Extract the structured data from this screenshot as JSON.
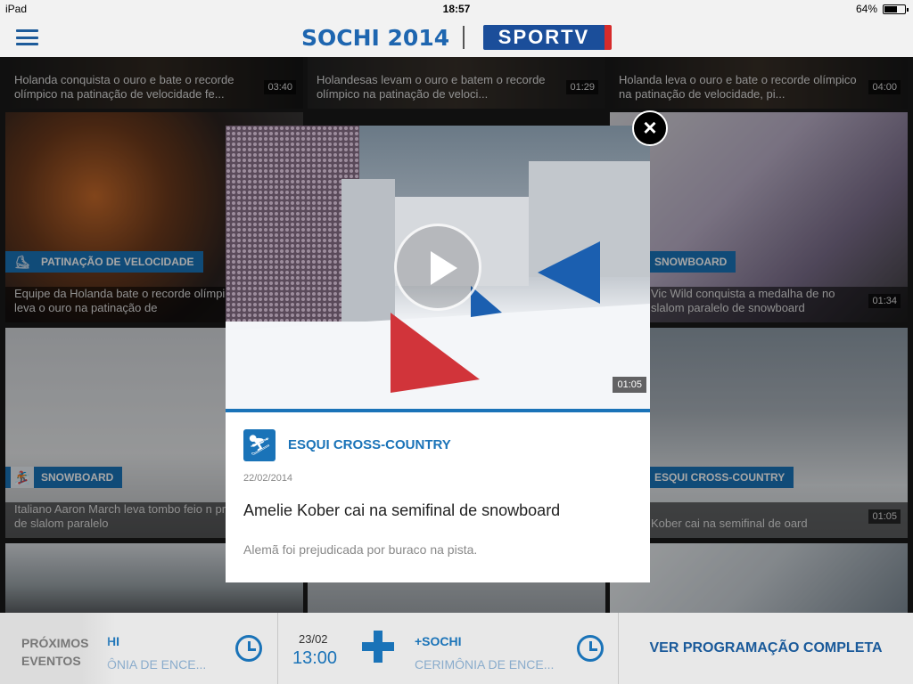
{
  "status": {
    "device": "iPad",
    "time": "18:57",
    "battery": "64%",
    "battery_fill": 0.64
  },
  "header": {
    "logo_left": "SOCHI 2014",
    "logo_right": "SPORTV"
  },
  "tiles": [
    {
      "caption": "Holanda conquista o ouro e bate o recorde olímpico na patinação de velocidade fe...",
      "duration": "03:40"
    },
    {
      "caption": "Holandesas levam o ouro e batem o recorde olímpico na patinação de veloci...",
      "duration": "01:29"
    },
    {
      "caption": "Holanda leva o ouro e bate o recorde olímpico na patinação de velocidade, pi...",
      "duration": "04:00"
    },
    {
      "sport": "PATINAÇÃO DE VELOCIDADE",
      "caption": "Equipe da Holanda bate o recorde olímpico e leva o ouro na patinação de",
      "duration": ""
    },
    {
      "sport": "SNOWBOARD",
      "caption": "Vic Wild conquista a medalha de no slalom paralelo de snowboard",
      "duration": "01:34"
    },
    {
      "sport": "SNOWBOARD",
      "caption": "Italiano Aaron March leva tombo feio n prova de slalom paralelo",
      "duration": ""
    },
    {
      "sport": "ESQUI CROSS-COUNTRY",
      "caption": "Kober cai na semifinal de oard",
      "duration": "01:05"
    }
  ],
  "modal": {
    "duration": "01:05",
    "sport": "ESQUI CROSS-COUNTRY",
    "date": "22/02/2014",
    "title": "Amelie Kober cai na semifinal de snowboard",
    "description": "Alemã foi prejudicada por buraco na pista.",
    "close_label": "×"
  },
  "bottom": {
    "proximos": "PRÓXIMOS EVENTOS",
    "partial_event": "HI",
    "partial_sub": "ÔNIA DE ENCE...",
    "date": "23/02",
    "time": "13:00",
    "event": "+SOCHI",
    "event_sub": "CERIMÔNIA DE ENCE...",
    "ver_programacao": "VER PROGRAMAÇÃO COMPLETA"
  }
}
